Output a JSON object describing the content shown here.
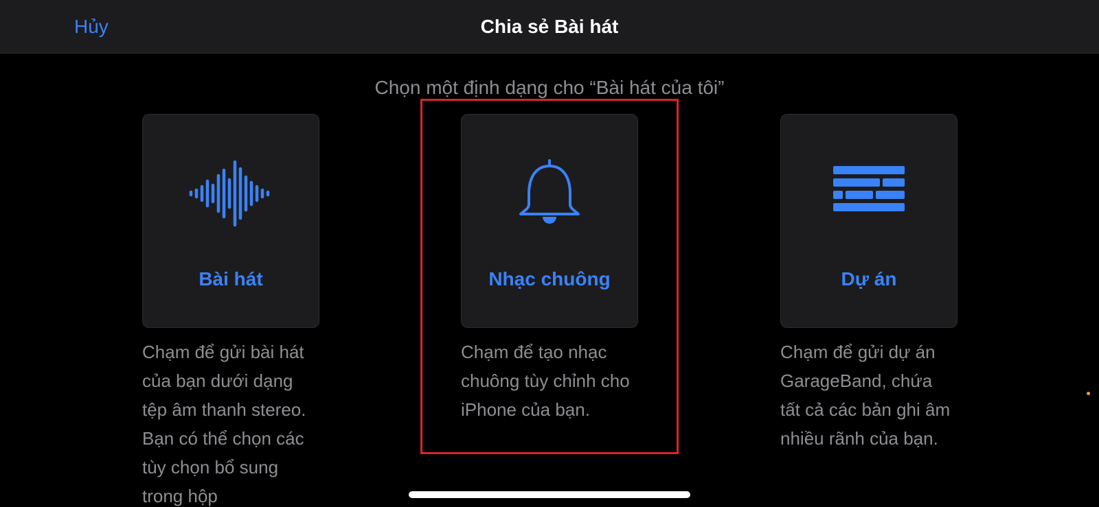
{
  "navbar": {
    "cancel_label": "Hủy",
    "title": "Chia sẻ Bài hát"
  },
  "subtitle": "Chọn một định dạng cho “Bài hát của tôi”",
  "options": [
    {
      "label": "Bài hát",
      "icon": "waveform-icon",
      "description": "Chạm để gửi bài hát của bạn dưới dạng tệp âm thanh stereo. Bạn có thể chọn các tùy chọn bổ sung trong hộp"
    },
    {
      "label": "Nhạc chuông",
      "icon": "bell-icon",
      "description": "Chạm để tạo nhạc chuông tùy chỉnh cho iPhone của bạn."
    },
    {
      "label": "Dự án",
      "icon": "bricks-icon",
      "description": "Chạm để gửi dự án GarageBand, chứa tất cả các bản ghi âm nhiều rãnh của bạn."
    }
  ],
  "colors": {
    "accent": "#3a82f7",
    "highlight": "#d7262b",
    "edge_dot": "#f0a030"
  }
}
